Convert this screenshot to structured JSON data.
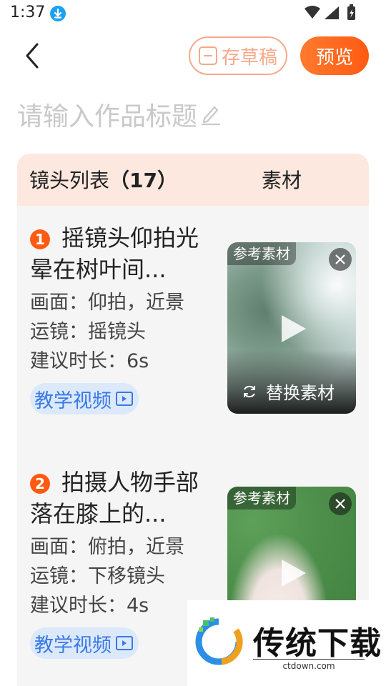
{
  "status_bar": {
    "time": "1:37",
    "icons": [
      "download-icon",
      "wifi-icon",
      "signal-icon",
      "battery-icon"
    ]
  },
  "header": {
    "back_icon": "back-arrow-icon",
    "draft_label": "存草稿",
    "preview_label": "预览"
  },
  "title_input": {
    "placeholder": "请输入作品标题",
    "icon": "pencil-icon"
  },
  "shot_list": {
    "title": "镜头列表",
    "count": "（17）",
    "material_column": "素材",
    "shots": [
      {
        "number": "1",
        "title": "摇镜头仰拍光晕在树叶间...",
        "picture": "画面：仰拍，近景",
        "camera": "运镜：摇镜头",
        "duration": "建议时长：6s",
        "tutorial_label": "教学视频",
        "material_label": "参考素材",
        "replace_label": "替换素材"
      },
      {
        "number": "2",
        "title": "拍摄人物手部落在膝上的...",
        "picture": "画面：俯拍，近景",
        "camera": "运镜：下移镜头",
        "duration": "建议时长：4s",
        "tutorial_label": "教学视频",
        "material_label": "参考素材"
      }
    ]
  },
  "watermark": {
    "text": "传统下载",
    "sub": "ctdown.com"
  },
  "colors": {
    "accent": "#ff5a12",
    "draft_border": "#f5a98a",
    "panel_header": "#fde8df",
    "tutorial_text": "#3a78e6",
    "tutorial_bg": "#dbe9fb"
  }
}
